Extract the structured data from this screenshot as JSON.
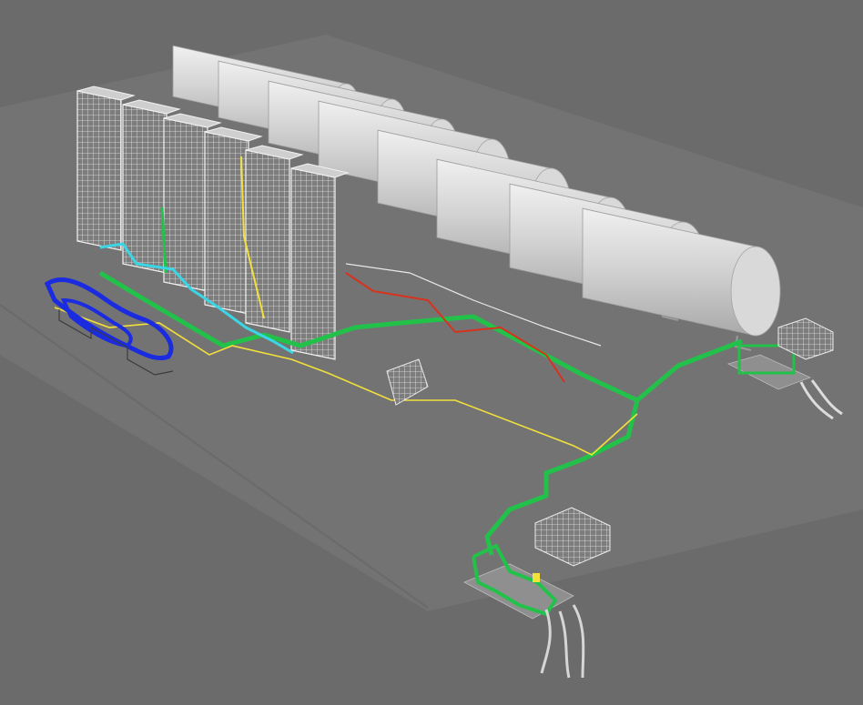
{
  "scene": {
    "colors": {
      "background": "#6b6b6b",
      "ground": "#777777",
      "tank": "#cfcfcf",
      "vaporizer": "#d8d8d8",
      "pipe_green": "#22c24a",
      "pipe_cyan": "#3ad6e6",
      "pipe_yellow": "#f2e03c",
      "pipe_red": "#d8321e",
      "pipe_blue": "#1a2be0",
      "pipe_white": "#e8e8e8"
    },
    "counts": {
      "storage_tanks": 8,
      "vaporizer_towers": 6,
      "skids": 2
    }
  }
}
